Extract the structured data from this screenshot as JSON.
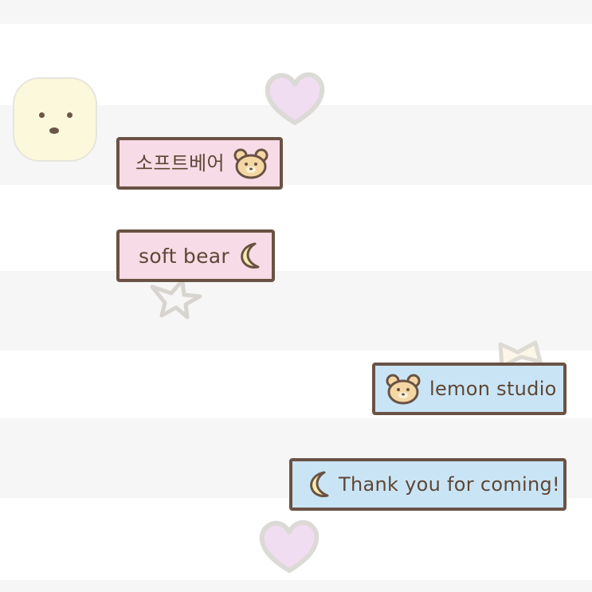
{
  "chat": {
    "messages": [
      {
        "text": "소프트베어",
        "side": "left",
        "color": "pink",
        "icon": "bear-icon"
      },
      {
        "text": "soft bear",
        "side": "left",
        "color": "pink",
        "icon": "moon-icon"
      },
      {
        "text": "lemon studio",
        "side": "right",
        "color": "blue",
        "icon": "bear-icon"
      },
      {
        "text": "Thank you for coming!",
        "side": "right",
        "color": "blue",
        "icon": "moon-icon"
      }
    ]
  },
  "colors": {
    "background": "#ffffff",
    "stripe": "#f6f6f6",
    "bubble_pink": "#f7dbe6",
    "bubble_blue": "#c9e5f5",
    "outline": "#6a5245",
    "text": "#5f4636",
    "avatar": "#fbf8dc",
    "heart": "#f1ddf1"
  },
  "decorations": [
    "heart-icon",
    "star-icon",
    "bow-icon",
    "bear-icon",
    "moon-icon"
  ]
}
